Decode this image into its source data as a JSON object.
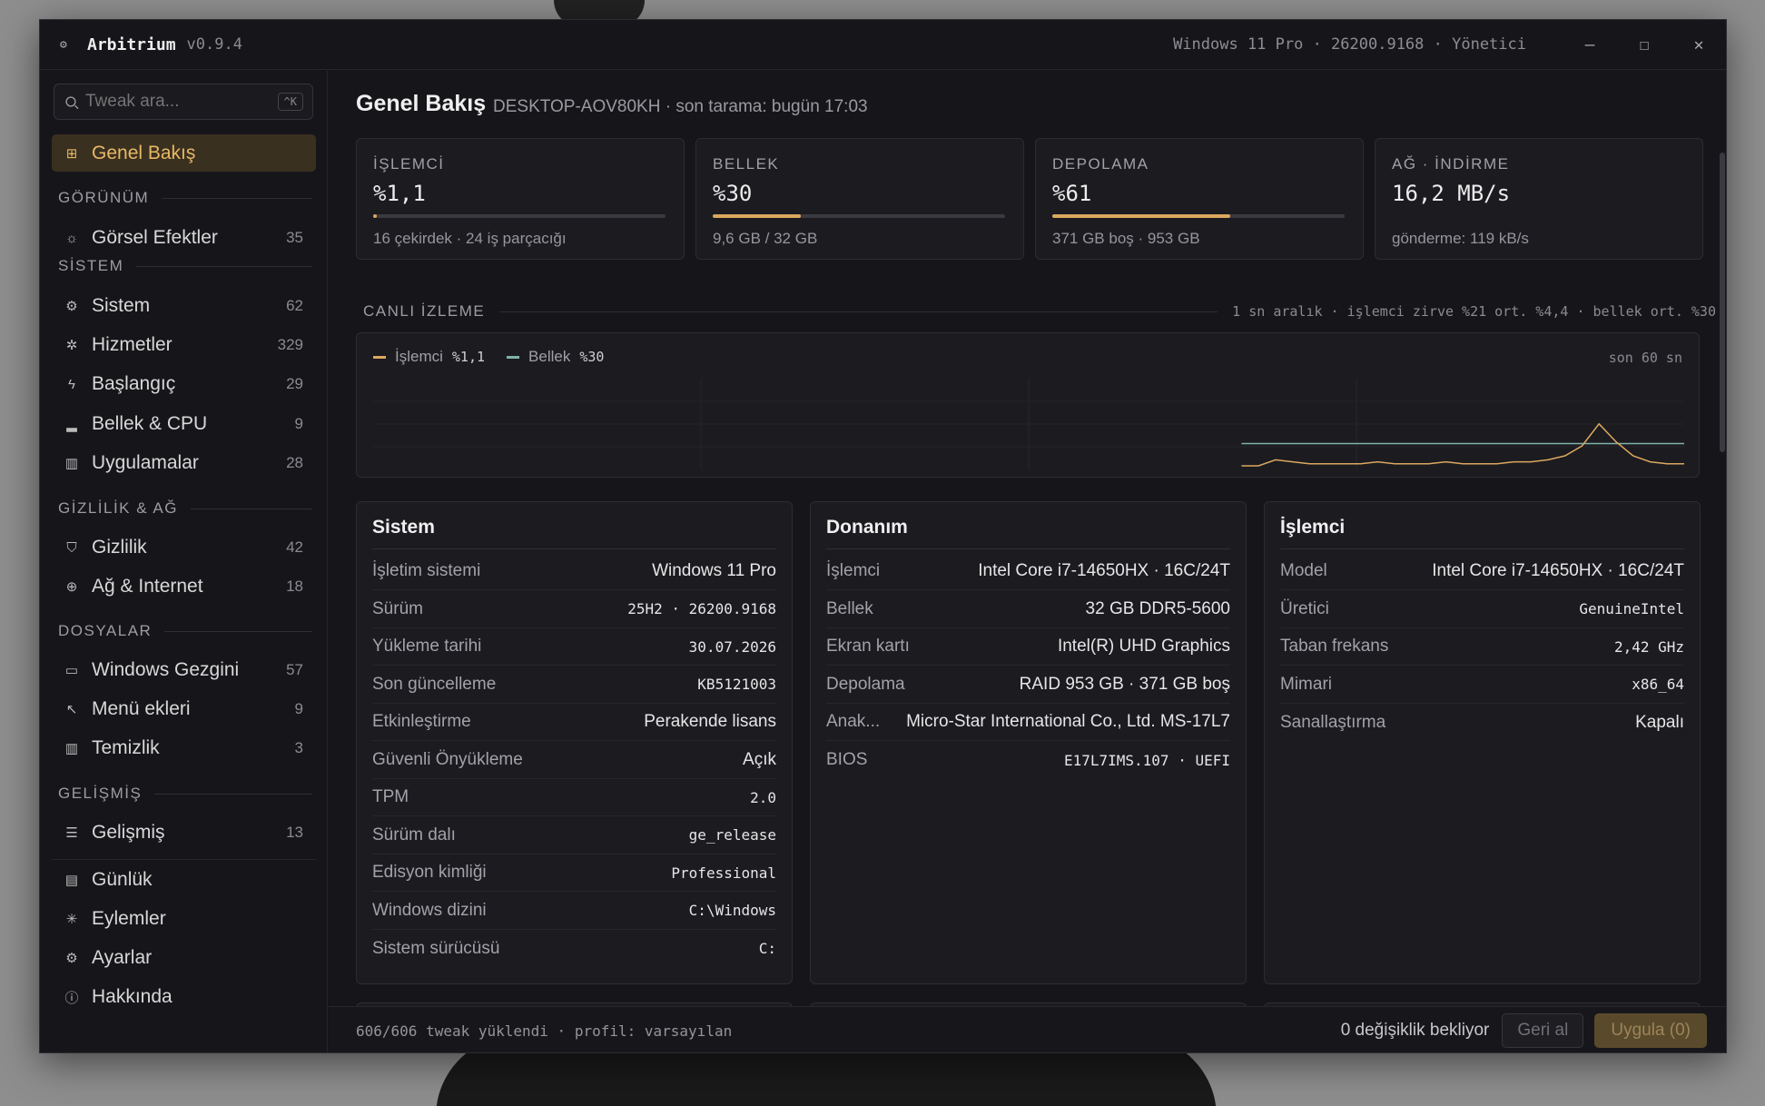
{
  "titlebar": {
    "app_name": "Arbitrium",
    "version": "v0.9.4",
    "system": "Windows 11 Pro · 26200.9168 · Yönetici",
    "minimize": "—",
    "maximize": "☐",
    "close": "✕"
  },
  "sidebar": {
    "search_placeholder": "Tweak ara...",
    "search_shortcut": "^K",
    "active": {
      "label": "Genel Bakış",
      "icon": "grid-icon"
    },
    "sections": {
      "gorunum": "GÖRÜNÜM",
      "sistem": "SİSTEM",
      "gizlilik": "GİZLİLİK & AĞ",
      "dosyalar": "DOSYALAR",
      "gelismis": "GELİŞMİŞ"
    },
    "items": [
      {
        "label": "Görsel Efektler",
        "count": "35",
        "icon": "sun-icon"
      },
      {
        "label": "Sistem",
        "count": "62",
        "icon": "gear-icon"
      },
      {
        "label": "Hizmetler",
        "count": "329",
        "icon": "cog-icon"
      },
      {
        "label": "Başlangıç",
        "count": "29",
        "icon": "bolt-icon"
      },
      {
        "label": "Bellek & CPU",
        "count": "9",
        "icon": "bars-icon"
      },
      {
        "label": "Uygulamalar",
        "count": "28",
        "icon": "trash-icon"
      },
      {
        "label": "Gizlilik",
        "count": "42",
        "icon": "shield-icon"
      },
      {
        "label": "Ağ & Internet",
        "count": "18",
        "icon": "globe-icon"
      },
      {
        "label": "Windows Gezgini",
        "count": "57",
        "icon": "folder-icon"
      },
      {
        "label": "Menü ekleri",
        "count": "9",
        "icon": "cursor-icon"
      },
      {
        "label": "Temizlik",
        "count": "3",
        "icon": "bin-icon"
      },
      {
        "label": "Gelişmiş",
        "count": "13",
        "icon": "sliders-icon"
      },
      {
        "label": "Günlük",
        "icon": "log-icon"
      },
      {
        "label": "Eylemler",
        "icon": "asterisk-icon"
      },
      {
        "label": "Ayarlar",
        "icon": "settings-icon"
      },
      {
        "label": "Hakkında",
        "icon": "info-icon"
      }
    ]
  },
  "header": {
    "title": "Genel Bakış",
    "subtitle": "DESKTOP-AOV80KH · son tarama: bugün 17:03"
  },
  "stats": [
    {
      "label": "İŞLEMCİ",
      "value": "%1,1",
      "sub": "16 çekirdek · 24 iş parçacığı",
      "percent": 1.1
    },
    {
      "label": "BELLEK",
      "value": "%30",
      "sub": "9,6 GB / 32 GB",
      "percent": 30
    },
    {
      "label": "DEPOLAMA",
      "value": "%61",
      "sub": "371 GB boş · 953 GB",
      "percent": 61
    },
    {
      "label": "AĞ · İNDİRME",
      "value": "16,2 MB/s",
      "sub": "gönderme: 119 kB/s"
    }
  ],
  "live": {
    "title": "CANLI İZLEME",
    "meta": "1 sn aralık · işlemci zirve %21 ort. %4,4 · bellek ort. %30",
    "window": "son 60 sn",
    "legend": [
      {
        "name": "İşlemci",
        "value": "%1,1",
        "color": "#dca85e"
      },
      {
        "name": "Bellek",
        "value": "%30",
        "color": "#7fb3a8"
      }
    ],
    "cpu_series": [
      0,
      0,
      0,
      0,
      0,
      0,
      0,
      0,
      0,
      0,
      0,
      0,
      0,
      0,
      0,
      0,
      0,
      0,
      0,
      0,
      0,
      0,
      0,
      0,
      0,
      0,
      0,
      0,
      0,
      0,
      0,
      0,
      0,
      0,
      0,
      0,
      0,
      0,
      0,
      0,
      0,
      0,
      0,
      0,
      0,
      0,
      0,
      0,
      0,
      0,
      0,
      0,
      0,
      3,
      2,
      1,
      1,
      1,
      1,
      2,
      1,
      1,
      1,
      2,
      1,
      1,
      1,
      2,
      2,
      3,
      5,
      10,
      21,
      12,
      5,
      2,
      1,
      1
    ],
    "mem_series_value": 30,
    "series_start_index": 51
  },
  "panels": {
    "sistem": {
      "title": "Sistem",
      "rows": [
        {
          "k": "İşletim sistemi",
          "v": "Windows 11 Pro"
        },
        {
          "k": "Sürüm",
          "v": "25H2 · 26200.9168"
        },
        {
          "k": "Yükleme tarihi",
          "v": "30.07.2026"
        },
        {
          "k": "Son güncelleme",
          "v": "KB5121003"
        },
        {
          "k": "Etkinleştirme",
          "v": "Perakende lisans"
        },
        {
          "k": "Güvenli Önyükleme",
          "v": "Açık"
        },
        {
          "k": "TPM",
          "v": "2.0"
        },
        {
          "k": "Sürüm dalı",
          "v": "ge_release"
        },
        {
          "k": "Edisyon kimliği",
          "v": "Professional"
        },
        {
          "k": "Windows dizini",
          "v": "C:\\Windows"
        },
        {
          "k": "Sistem sürücüsü",
          "v": "C:"
        }
      ]
    },
    "donanim": {
      "title": "Donanım",
      "rows": [
        {
          "k": "İşlemci",
          "v": "Intel Core i7-14650HX · 16C/24T"
        },
        {
          "k": "Bellek",
          "v": "32 GB DDR5-5600"
        },
        {
          "k": "Ekran kartı",
          "v": "Intel(R) UHD Graphics"
        },
        {
          "k": "Depolama",
          "v": "RAID 953 GB · 371 GB boş"
        },
        {
          "k": "Anak...",
          "v": "Micro-Star International Co., Ltd. MS-17L7"
        },
        {
          "k": "BIOS",
          "v": "E17L7IMS.107 · UEFI"
        }
      ]
    },
    "islemci": {
      "title": "İşlemci",
      "rows": [
        {
          "k": "Model",
          "v": "Intel Core i7-14650HX · 16C/24T"
        },
        {
          "k": "Üretici",
          "v": "GenuineIntel"
        },
        {
          "k": "Taban frekans",
          "v": "2,42 GHz"
        },
        {
          "k": "Mimari",
          "v": "x86_64"
        },
        {
          "k": "Sanallaştırma",
          "v": "Kapalı"
        }
      ]
    }
  },
  "footer": {
    "status": "606/606 tweak yüklendi · profil: varsayılan",
    "pending": "0 değişiklik bekliyor",
    "undo": "Geri al",
    "apply": "Uygula (0)"
  },
  "colors": {
    "accent": "#dca85e",
    "memory": "#7fb3a8"
  }
}
